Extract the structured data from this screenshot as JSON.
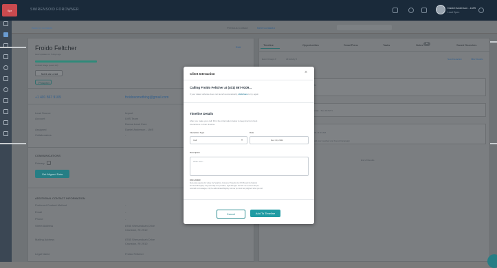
{
  "app": {
    "logo_text": "Spr",
    "brand": "SWIRENSOID FOROWNER"
  },
  "user": {
    "name": "Daniel Anderson - LMS",
    "role": "Lead Open"
  },
  "breadcrumb": "Back to Contacts",
  "top_mid": {
    "label1": "Previous Contact",
    "label2": "Next Contact ▸"
  },
  "contact": {
    "name": "Froido Feltcher",
    "subtitle": "Last Updated on 5 days ago",
    "status_label": "Contact Stage (Lead 1/3)",
    "lead_btn": "Mark as Lead",
    "tag": "Prospect",
    "edit": "Edit",
    "phone": "+1 401 867 9109",
    "email": "froidosomething@gmail.com"
  },
  "info_rows": [
    {
      "label": "Lead Source",
      "value": "Import"
    },
    {
      "label": "Account",
      "value": "LMS Team"
    },
    {
      "label": "",
      "value": "Donna Lead Core"
    },
    {
      "label": "Assigned",
      "value": "Daniel Anderson - LMS"
    },
    {
      "label": "Collaborators",
      "value": "-"
    }
  ],
  "comm": {
    "title": "COMMUNICATIONS",
    "primary": "Primary",
    "button": "Get Aligned Data"
  },
  "additional": {
    "title": "ADDITIONAL CONTACT INFORMATION",
    "rows": [
      {
        "label": "Preferred Contact Method",
        "value": "-"
      },
      {
        "label": "Email",
        "value": "-"
      },
      {
        "label": "Phone",
        "value": "-"
      },
      {
        "label": "Street Address",
        "value": "8785 Shenandoah Drive"
      },
      {
        "label": "",
        "value": "Cranston, RI 2910"
      },
      {
        "label": "Mailing Address",
        "value": "8785 Shenandoah Drive"
      },
      {
        "label": "",
        "value": "Cranston, RI 2910"
      },
      {
        "label": "Legal Name",
        "value": "Froido Feltcher"
      }
    ]
  },
  "tabs": [
    "Timeline",
    "Opportunities",
    "SmartPlans",
    "Tasks",
    "Notes",
    "Saved Searches"
  ],
  "notes_count": "1",
  "filters": {
    "f1": "Event Groups ▾",
    "f2": "All Activity ▾",
    "a1": "New Interaction",
    "a2": "Filter Results"
  },
  "timeline": {
    "t1": "AM",
    "t2": "Ready · Tour Aft 5271",
    "t3": "4/11 11:44 AM",
    "t4": "Bold your reached and bound Campaign",
    "end": "End of Results"
  },
  "modal": {
    "title": "Client Interaction",
    "close": "×",
    "calling": "Calling Froido Feltcher at (401) 867-9109...",
    "hint_pre": "If your dialer software does not launch automatically,",
    "hint_link": "click here",
    "hint_post": "to try again",
    "section": "Timeline Details",
    "section_desc1": "After you make your call, fill in the information below to keep track of client",
    "section_desc2": "interactions in their timeline.",
    "type_label": "Interaction Type",
    "type_value": "Call",
    "date_label": "Date",
    "date_value": "Dec 10, 2022",
    "desc_label": "Description",
    "desc_placeholder": "Write here...",
    "disclaimer_title": "DISCLAIMER",
    "disclaimer1": "Real estate agents who violate the Telephone Consumer Protection Act (TCPA) and the National",
    "disclaimer2": "Do-Not-Call Registry may personally incur penalties, legal damages. Do NOT use services with pre-",
    "disclaimer3": "recorded text messages, only the authenticated Registry and use your own best judgment when you call.",
    "cancel": "Cancel",
    "add": "Add To Timeline"
  }
}
